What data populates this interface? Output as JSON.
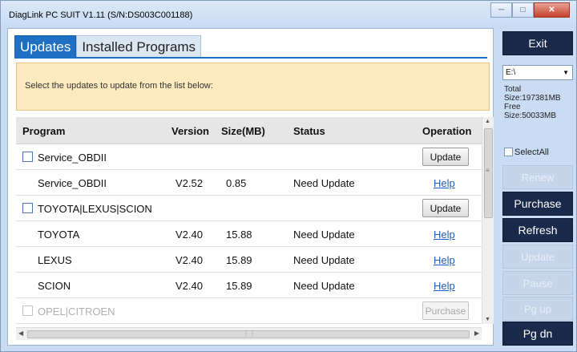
{
  "window": {
    "title": "DiagLink PC SUIT V1.11  (S/N:DS003C001188)"
  },
  "tabs": [
    {
      "label": "Updates"
    },
    {
      "label": "Installed Programs"
    }
  ],
  "notice": "Select the updates to update from the list below:",
  "columns": {
    "program": "Program",
    "version": "Version",
    "size": "Size(MB)",
    "status": "Status",
    "operation": "Operation"
  },
  "rows": [
    {
      "program": "Service_OBDII",
      "version": "",
      "size": "",
      "status": "",
      "op": "Update"
    },
    {
      "program": "Service_OBDII",
      "version": "V2.52",
      "size": "0.85",
      "status": "Need Update",
      "op": "Help"
    },
    {
      "program": "TOYOTA|LEXUS|SCION",
      "version": "",
      "size": "",
      "status": "",
      "op": "Update"
    },
    {
      "program": "TOYOTA",
      "version": "V2.40",
      "size": "15.88",
      "status": "Need Update",
      "op": "Help"
    },
    {
      "program": "LEXUS",
      "version": "V2.40",
      "size": "15.89",
      "status": "Need Update",
      "op": "Help"
    },
    {
      "program": "SCION",
      "version": "V2.40",
      "size": "15.89",
      "status": "Need Update",
      "op": "Help"
    },
    {
      "program": "OPEL|CITROEN",
      "version": "",
      "size": "",
      "status": "",
      "op": "Purchase"
    }
  ],
  "sidebar": {
    "exit": "Exit",
    "drive": "E:\\",
    "total_label": "Total",
    "total_size": "Size:197381MB",
    "free_label": "Free",
    "free_size": "Size:50033MB",
    "select_all": "SelectAll",
    "renew": "Renew",
    "purchase": "Purchase",
    "refresh": "Refresh",
    "update": "Update",
    "pause": "Pause",
    "pg_up": "Pg up",
    "pg_dn": "Pg dn"
  },
  "icons": {
    "minimize": "minimize-icon",
    "maximize": "maximize-icon",
    "close": "close-icon",
    "dropdown": "chevron-down-icon"
  }
}
